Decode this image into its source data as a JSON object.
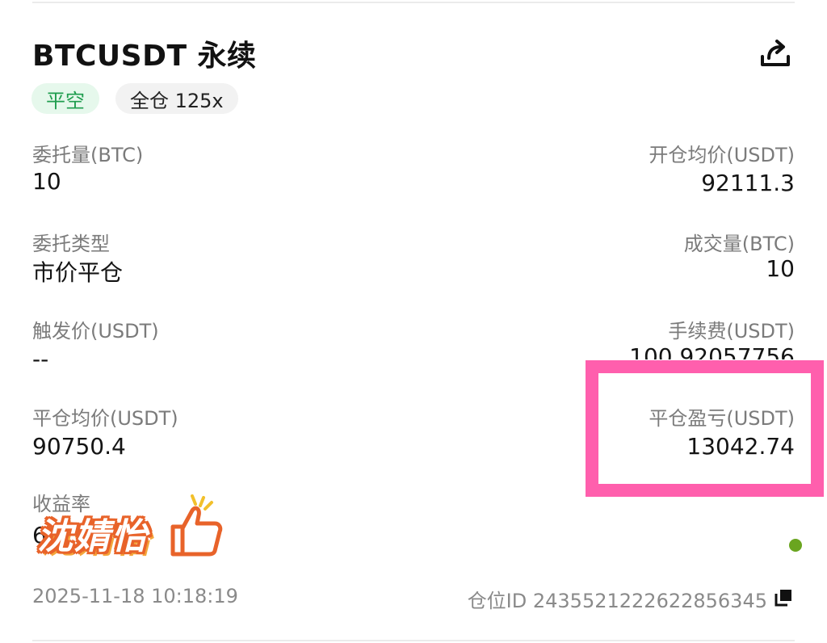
{
  "header": {
    "symbol_title": "BTCUSDT 永续",
    "share_icon": "share-icon"
  },
  "badges": {
    "direction": "平空",
    "margin_mode": "全仓 125x"
  },
  "fields": {
    "order_qty_label": "委托量(BTC)",
    "order_qty_value": "10",
    "open_avg_label": "开仓均价(USDT)",
    "open_avg_value": "92111.3",
    "order_type_label": "委托类型",
    "order_type_value": "市价平仓",
    "filled_qty_label": "成交量(BTC)",
    "filled_qty_value": "10",
    "trigger_price_label": "触发价(USDT)",
    "trigger_price_value": "--",
    "fee_label": "手续费(USDT)",
    "fee_value_partial": "100.92057756",
    "close_avg_label": "平仓均价(USDT)",
    "close_avg_value": "90750.4",
    "close_pnl_label": "平仓盈亏(USDT)",
    "close_pnl_value": "13042.74",
    "roi_label": "收益率",
    "roi_value_partial": "6"
  },
  "watermark": {
    "text": "沈婧怡"
  },
  "footer": {
    "timestamp": "2025-11-18 10:18:19",
    "position_id": "仓位ID 2435521222622856345",
    "copy_icon": "copy-icon"
  },
  "colors": {
    "highlight": "#ff5fad",
    "short_badge_bg": "#e6f8ec",
    "short_badge_text": "#1f9d4e",
    "status_dot": "#6aa520"
  }
}
